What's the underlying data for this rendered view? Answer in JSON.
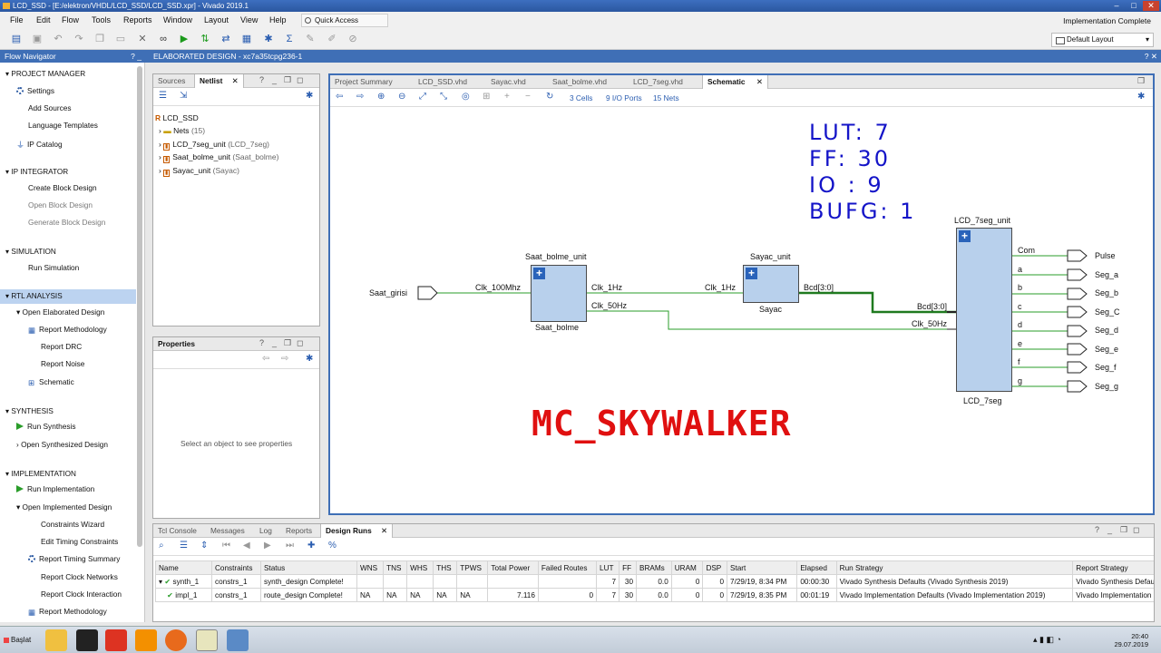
{
  "window": {
    "title": "LCD_SSD - [E:/elektron/VHDL/LCD_SSD/LCD_SSD.xpr] - Vivado 2019.1"
  },
  "menu": [
    "File",
    "Edit",
    "Flow",
    "Tools",
    "Reports",
    "Window",
    "Layout",
    "View",
    "Help"
  ],
  "quick_access": "Quick Access",
  "status_right": "Implementation Complete",
  "layout_select": "Default Layout",
  "flow_nav": {
    "title": "Flow Navigator",
    "items": [
      {
        "label": "PROJECT MANAGER",
        "kind": "section"
      },
      {
        "label": "Settings",
        "kind": "gear"
      },
      {
        "label": "Add Sources",
        "kind": "item"
      },
      {
        "label": "Language Templates",
        "kind": "item"
      },
      {
        "label": "IP Catalog",
        "kind": "item"
      },
      {
        "label": "IP INTEGRATOR",
        "kind": "section"
      },
      {
        "label": "Create Block Design",
        "kind": "item"
      },
      {
        "label": "Open Block Design",
        "kind": "disabled"
      },
      {
        "label": "Generate Block Design",
        "kind": "disabled"
      },
      {
        "label": "SIMULATION",
        "kind": "section"
      },
      {
        "label": "Run Simulation",
        "kind": "item"
      },
      {
        "label": "RTL ANALYSIS",
        "kind": "section-selected"
      },
      {
        "label": "Open Elaborated Design",
        "kind": "bold"
      },
      {
        "label": "Report Methodology",
        "kind": "item"
      },
      {
        "label": "Report DRC",
        "kind": "item"
      },
      {
        "label": "Report Noise",
        "kind": "item"
      },
      {
        "label": "Schematic",
        "kind": "item"
      },
      {
        "label": "SYNTHESIS",
        "kind": "section"
      },
      {
        "label": "Run Synthesis",
        "kind": "play"
      },
      {
        "label": "Open Synthesized Design",
        "kind": "item"
      },
      {
        "label": "IMPLEMENTATION",
        "kind": "section"
      },
      {
        "label": "Run Implementation",
        "kind": "play"
      },
      {
        "label": "Open Implemented Design",
        "kind": "item"
      },
      {
        "label": "Constraints Wizard",
        "kind": "item"
      },
      {
        "label": "Edit Timing Constraints",
        "kind": "item"
      },
      {
        "label": "Report Timing Summary",
        "kind": "item"
      },
      {
        "label": "Report Clock Networks",
        "kind": "item"
      },
      {
        "label": "Report Clock Interaction",
        "kind": "item"
      },
      {
        "label": "Report Methodology",
        "kind": "item"
      }
    ]
  },
  "elaborated_header": "ELABORATED DESIGN - xc7a35tcpg236-1",
  "sources_panel": {
    "tabs": [
      "Sources",
      "Netlist"
    ],
    "tree": [
      {
        "label": "LCD_SSD",
        "sub": ""
      },
      {
        "label": "Nets",
        "sub": "(15)"
      },
      {
        "label": "LCD_7seg_unit",
        "sub": "(LCD_7seg)"
      },
      {
        "label": "Saat_bolme_unit",
        "sub": "(Saat_bolme)"
      },
      {
        "label": "Sayac_unit",
        "sub": "(Sayac)"
      }
    ]
  },
  "properties_panel": {
    "title": "Properties",
    "empty_text": "Select an object to see properties"
  },
  "editor_tabs": [
    "Project Summary",
    "LCD_SSD.vhd",
    "Sayac.vhd",
    "Saat_bolme.vhd",
    "LCD_7seg.vhd",
    "Schematic"
  ],
  "schematic_stats": {
    "cells": "3 Cells",
    "io_ports": "9 I/O Ports",
    "nets": "15 Nets"
  },
  "schematic": {
    "input_port": "Saat_girisi",
    "saat_bolme": {
      "instance": "Saat_bolme_unit",
      "type": "Saat_bolme",
      "in": "Clk_100Mhz",
      "out1": "Clk_1Hz",
      "out2": "Clk_50Hz"
    },
    "sayac": {
      "instance": "Sayac_unit",
      "type": "Sayac",
      "in": "Clk_1Hz",
      "out": "Bcd[3:0]"
    },
    "lcd": {
      "instance": "LCD_7seg_unit",
      "type": "LCD_7seg",
      "in1": "Bcd[3:0]",
      "in2": "Clk_50Hz",
      "outs": [
        "Com",
        "a",
        "b",
        "c",
        "d",
        "e",
        "f",
        "g"
      ]
    },
    "output_ports": [
      "Pulse",
      "Seg_a",
      "Seg_b",
      "Seg_C",
      "Seg_d",
      "Seg_e",
      "Seg_f",
      "Seg_g"
    ],
    "annotation_lines": [
      "LUT:  7",
      "FF: 30",
      "IO : 9",
      "BUFG: 1"
    ],
    "watermark": "MC_SKYWALKER"
  },
  "bottom_tabs": [
    "Tcl Console",
    "Messages",
    "Log",
    "Reports",
    "Design Runs"
  ],
  "design_runs": {
    "columns": [
      "Name",
      "Constraints",
      "Status",
      "WNS",
      "TNS",
      "WHS",
      "THS",
      "TPWS",
      "Total Power",
      "Failed Routes",
      "LUT",
      "FF",
      "BRAMs",
      "URAM",
      "DSP",
      "Start",
      "Elapsed",
      "Run Strategy",
      "Report Strategy"
    ],
    "rows": [
      [
        "synth_1",
        "constrs_1",
        "synth_design Complete!",
        "",
        "",
        "",
        "",
        "",
        "",
        "",
        "7",
        "30",
        "0.0",
        "0",
        "0",
        "7/29/19, 8:34 PM",
        "00:00:30",
        "Vivado Synthesis Defaults (Vivado Synthesis 2019)",
        "Vivado Synthesis Defau"
      ],
      [
        "impl_1",
        "constrs_1",
        "route_design Complete!",
        "NA",
        "NA",
        "NA",
        "NA",
        "NA",
        "7.116",
        "0",
        "7",
        "30",
        "0.0",
        "0",
        "0",
        "7/29/19, 8:35 PM",
        "00:01:19",
        "Vivado Implementation Defaults (Vivado Implementation 2019)",
        "Vivado Implementation I"
      ]
    ]
  },
  "taskbar": {
    "start": "Başlat",
    "time": "20:40",
    "date": "29.07.2019"
  },
  "colors": {
    "accent": "#3f6fb6",
    "net": "#2a9d2a",
    "annot": "#1414c8",
    "watermark": "#e01010",
    "block": "#b8d0ec"
  }
}
